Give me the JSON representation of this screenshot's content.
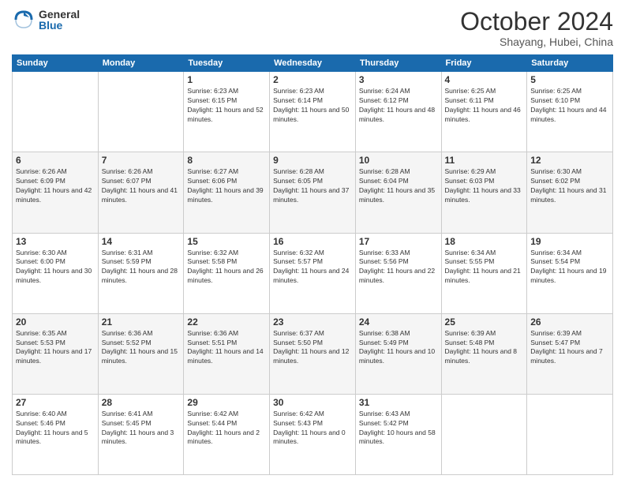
{
  "logo": {
    "general": "General",
    "blue": "Blue"
  },
  "title": "October 2024",
  "location": "Shayang, Hubei, China",
  "weekdays": [
    "Sunday",
    "Monday",
    "Tuesday",
    "Wednesday",
    "Thursday",
    "Friday",
    "Saturday"
  ],
  "weeks": [
    [
      {
        "day": "",
        "sunrise": "",
        "sunset": "",
        "daylight": ""
      },
      {
        "day": "",
        "sunrise": "",
        "sunset": "",
        "daylight": ""
      },
      {
        "day": "1",
        "sunrise": "Sunrise: 6:23 AM",
        "sunset": "Sunset: 6:15 PM",
        "daylight": "Daylight: 11 hours and 52 minutes."
      },
      {
        "day": "2",
        "sunrise": "Sunrise: 6:23 AM",
        "sunset": "Sunset: 6:14 PM",
        "daylight": "Daylight: 11 hours and 50 minutes."
      },
      {
        "day": "3",
        "sunrise": "Sunrise: 6:24 AM",
        "sunset": "Sunset: 6:12 PM",
        "daylight": "Daylight: 11 hours and 48 minutes."
      },
      {
        "day": "4",
        "sunrise": "Sunrise: 6:25 AM",
        "sunset": "Sunset: 6:11 PM",
        "daylight": "Daylight: 11 hours and 46 minutes."
      },
      {
        "day": "5",
        "sunrise": "Sunrise: 6:25 AM",
        "sunset": "Sunset: 6:10 PM",
        "daylight": "Daylight: 11 hours and 44 minutes."
      }
    ],
    [
      {
        "day": "6",
        "sunrise": "Sunrise: 6:26 AM",
        "sunset": "Sunset: 6:09 PM",
        "daylight": "Daylight: 11 hours and 42 minutes."
      },
      {
        "day": "7",
        "sunrise": "Sunrise: 6:26 AM",
        "sunset": "Sunset: 6:07 PM",
        "daylight": "Daylight: 11 hours and 41 minutes."
      },
      {
        "day": "8",
        "sunrise": "Sunrise: 6:27 AM",
        "sunset": "Sunset: 6:06 PM",
        "daylight": "Daylight: 11 hours and 39 minutes."
      },
      {
        "day": "9",
        "sunrise": "Sunrise: 6:28 AM",
        "sunset": "Sunset: 6:05 PM",
        "daylight": "Daylight: 11 hours and 37 minutes."
      },
      {
        "day": "10",
        "sunrise": "Sunrise: 6:28 AM",
        "sunset": "Sunset: 6:04 PM",
        "daylight": "Daylight: 11 hours and 35 minutes."
      },
      {
        "day": "11",
        "sunrise": "Sunrise: 6:29 AM",
        "sunset": "Sunset: 6:03 PM",
        "daylight": "Daylight: 11 hours and 33 minutes."
      },
      {
        "day": "12",
        "sunrise": "Sunrise: 6:30 AM",
        "sunset": "Sunset: 6:02 PM",
        "daylight": "Daylight: 11 hours and 31 minutes."
      }
    ],
    [
      {
        "day": "13",
        "sunrise": "Sunrise: 6:30 AM",
        "sunset": "Sunset: 6:00 PM",
        "daylight": "Daylight: 11 hours and 30 minutes."
      },
      {
        "day": "14",
        "sunrise": "Sunrise: 6:31 AM",
        "sunset": "Sunset: 5:59 PM",
        "daylight": "Daylight: 11 hours and 28 minutes."
      },
      {
        "day": "15",
        "sunrise": "Sunrise: 6:32 AM",
        "sunset": "Sunset: 5:58 PM",
        "daylight": "Daylight: 11 hours and 26 minutes."
      },
      {
        "day": "16",
        "sunrise": "Sunrise: 6:32 AM",
        "sunset": "Sunset: 5:57 PM",
        "daylight": "Daylight: 11 hours and 24 minutes."
      },
      {
        "day": "17",
        "sunrise": "Sunrise: 6:33 AM",
        "sunset": "Sunset: 5:56 PM",
        "daylight": "Daylight: 11 hours and 22 minutes."
      },
      {
        "day": "18",
        "sunrise": "Sunrise: 6:34 AM",
        "sunset": "Sunset: 5:55 PM",
        "daylight": "Daylight: 11 hours and 21 minutes."
      },
      {
        "day": "19",
        "sunrise": "Sunrise: 6:34 AM",
        "sunset": "Sunset: 5:54 PM",
        "daylight": "Daylight: 11 hours and 19 minutes."
      }
    ],
    [
      {
        "day": "20",
        "sunrise": "Sunrise: 6:35 AM",
        "sunset": "Sunset: 5:53 PM",
        "daylight": "Daylight: 11 hours and 17 minutes."
      },
      {
        "day": "21",
        "sunrise": "Sunrise: 6:36 AM",
        "sunset": "Sunset: 5:52 PM",
        "daylight": "Daylight: 11 hours and 15 minutes."
      },
      {
        "day": "22",
        "sunrise": "Sunrise: 6:36 AM",
        "sunset": "Sunset: 5:51 PM",
        "daylight": "Daylight: 11 hours and 14 minutes."
      },
      {
        "day": "23",
        "sunrise": "Sunrise: 6:37 AM",
        "sunset": "Sunset: 5:50 PM",
        "daylight": "Daylight: 11 hours and 12 minutes."
      },
      {
        "day": "24",
        "sunrise": "Sunrise: 6:38 AM",
        "sunset": "Sunset: 5:49 PM",
        "daylight": "Daylight: 11 hours and 10 minutes."
      },
      {
        "day": "25",
        "sunrise": "Sunrise: 6:39 AM",
        "sunset": "Sunset: 5:48 PM",
        "daylight": "Daylight: 11 hours and 8 minutes."
      },
      {
        "day": "26",
        "sunrise": "Sunrise: 6:39 AM",
        "sunset": "Sunset: 5:47 PM",
        "daylight": "Daylight: 11 hours and 7 minutes."
      }
    ],
    [
      {
        "day": "27",
        "sunrise": "Sunrise: 6:40 AM",
        "sunset": "Sunset: 5:46 PM",
        "daylight": "Daylight: 11 hours and 5 minutes."
      },
      {
        "day": "28",
        "sunrise": "Sunrise: 6:41 AM",
        "sunset": "Sunset: 5:45 PM",
        "daylight": "Daylight: 11 hours and 3 minutes."
      },
      {
        "day": "29",
        "sunrise": "Sunrise: 6:42 AM",
        "sunset": "Sunset: 5:44 PM",
        "daylight": "Daylight: 11 hours and 2 minutes."
      },
      {
        "day": "30",
        "sunrise": "Sunrise: 6:42 AM",
        "sunset": "Sunset: 5:43 PM",
        "daylight": "Daylight: 11 hours and 0 minutes."
      },
      {
        "day": "31",
        "sunrise": "Sunrise: 6:43 AM",
        "sunset": "Sunset: 5:42 PM",
        "daylight": "Daylight: 10 hours and 58 minutes."
      },
      {
        "day": "",
        "sunrise": "",
        "sunset": "",
        "daylight": ""
      },
      {
        "day": "",
        "sunrise": "",
        "sunset": "",
        "daylight": ""
      }
    ]
  ]
}
